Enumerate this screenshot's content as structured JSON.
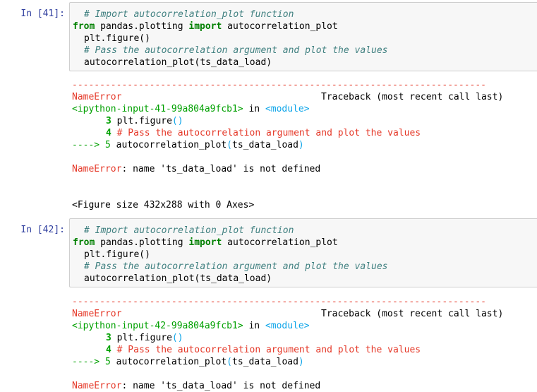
{
  "cells": [
    {
      "prompt": "In [41]:",
      "input": {
        "l1": "# Import autocorrelation_plot function",
        "l2_kw1": "from",
        "l2_mod": " pandas.plotting ",
        "l2_kw2": "import",
        "l2_name": " autocorrelation_plot",
        "l3": "plt.figure()",
        "l4": "# Pass the autocorrelation argument and plot the values",
        "l5": "autocorrelation_plot(ts_data_load)"
      },
      "output": {
        "dashes": "---------------------------------------------------------------------------",
        "error_name": "NameError",
        "traceback_label": "Traceback (most recent call last)",
        "ipython_input": "<ipython-input-41-99a804a9fcb1>",
        "in_word": " in ",
        "module": "<module>",
        "tb1_num": "3",
        "tb1_code_a": " plt.figure",
        "tb1_code_b": "()",
        "tb2_num": "4",
        "tb2_code": " # Pass the autocorrelation argument and plot the values",
        "tb3_arrow": "---->",
        "tb3_num": " 5",
        "tb3_code_a": " autocorrelation_plot",
        "tb3_code_b": "(",
        "tb3_code_c": "ts_data_load",
        "tb3_code_d": ")",
        "err_label": "NameError",
        "err_msg": ": name 'ts_data_load' is not defined",
        "figure_msg": "<Figure size 432x288 with 0 Axes>"
      }
    },
    {
      "prompt": "In [42]:",
      "input": {
        "l1": "# Import autocorrelation_plot function",
        "l2_kw1": "from",
        "l2_mod": " pandas.plotting ",
        "l2_kw2": "import",
        "l2_name": " autocorrelation_plot",
        "l3": "plt.figure()",
        "l4": "# Pass the autocorrelation argument and plot the values",
        "l5": "autocorrelation_plot(ts_data_load)"
      },
      "output": {
        "dashes": "---------------------------------------------------------------------------",
        "error_name": "NameError",
        "traceback_label": "Traceback (most recent call last)",
        "ipython_input": "<ipython-input-42-99a804a9fcb1>",
        "in_word": " in ",
        "module": "<module>",
        "tb1_num": "3",
        "tb1_code_a": " plt.figure",
        "tb1_code_b": "()",
        "tb2_num": "4",
        "tb2_code": " # Pass the autocorrelation argument and plot the values",
        "tb3_arrow": "---->",
        "tb3_num": " 5",
        "tb3_code_a": " autocorrelation_plot",
        "tb3_code_b": "(",
        "tb3_code_c": "ts_data_load",
        "tb3_code_d": ")",
        "err_label": "NameError",
        "err_msg": ": name 'ts_data_load' is not defined"
      }
    }
  ]
}
